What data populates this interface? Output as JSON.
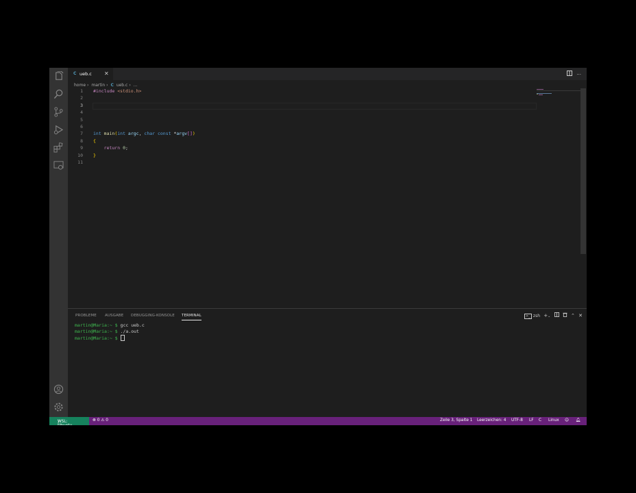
{
  "tab": {
    "lang_icon": "C",
    "filename": "ueb.c",
    "close": "✕"
  },
  "breadcrumb": {
    "seg1": "home",
    "seg2": "martin",
    "lang_icon": "C",
    "seg3": "ueb.c",
    "seg4": "..."
  },
  "editor": {
    "active_line": 3,
    "lines": [
      {
        "n": "1",
        "text": "#include <stdio.h>"
      },
      {
        "n": "2",
        "text": ""
      },
      {
        "n": "3",
        "text": ""
      },
      {
        "n": "4",
        "text": ""
      },
      {
        "n": "5",
        "text": ""
      },
      {
        "n": "6",
        "text": ""
      },
      {
        "n": "7",
        "text": "int main(int argc, char const *argv[])"
      },
      {
        "n": "8",
        "text": "{"
      },
      {
        "n": "9",
        "text": "    return 0;"
      },
      {
        "n": "10",
        "text": "}"
      },
      {
        "n": "11",
        "text": ""
      }
    ]
  },
  "panel": {
    "tabs": [
      "PROBLEME",
      "AUSGABE",
      "DEBUGGING-KONSOLE",
      "TERMINAL"
    ],
    "active_tab": "TERMINAL",
    "shell": "zsh",
    "terminal_lines": [
      {
        "prompt": "martin@Maria:~ $",
        "cmd": " gcc ueb.c"
      },
      {
        "prompt": "martin@Maria:~ $",
        "cmd": " ./a.out"
      },
      {
        "prompt": "martin@Maria:~ $",
        "cmd": " "
      }
    ]
  },
  "status": {
    "remote": "WSL: Ubuntu",
    "errors": "0",
    "warnings": "0",
    "position": "Zeile 3, Spalte 1",
    "indent": "Leerzeichen: 4",
    "encoding": "UTF-8",
    "eol": "LF",
    "language": "C",
    "os": "Linux"
  },
  "colors": {
    "statusbar": "#68217a",
    "remote": "#16825d",
    "editor_bg": "#1e1e1e",
    "activity_bg": "#333333"
  }
}
